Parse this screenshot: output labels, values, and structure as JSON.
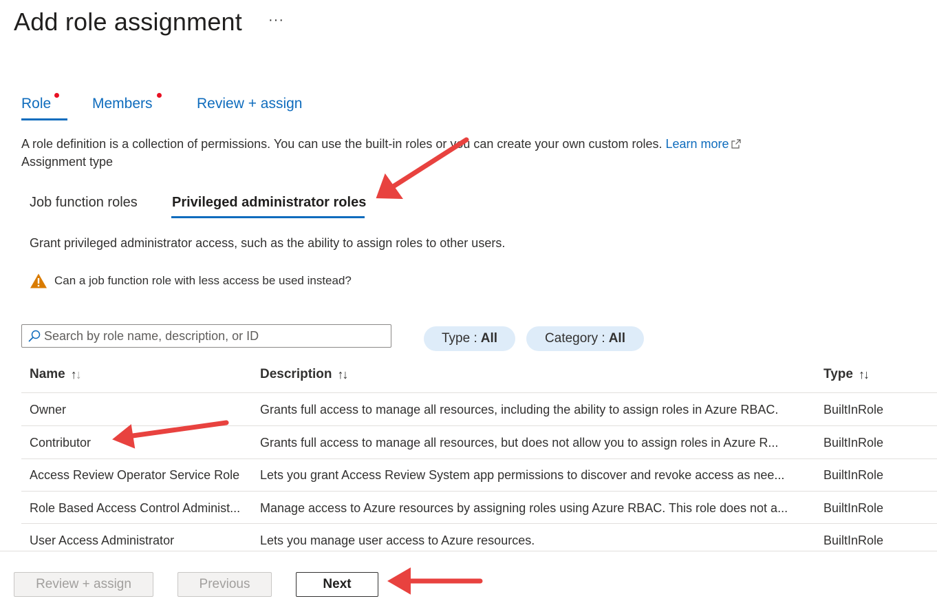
{
  "page": {
    "title": "Add role assignment",
    "more_label": "···"
  },
  "wizard_tabs": [
    {
      "label": "Role",
      "required": true,
      "active": true
    },
    {
      "label": "Members",
      "required": true,
      "active": false
    },
    {
      "label": "Review + assign",
      "required": false,
      "active": false
    }
  ],
  "intro": {
    "description": "A role definition is a collection of permissions. You can use the built-in roles or you can create your own custom roles.",
    "learn_more": "Learn more",
    "assignment_type_label": "Assignment type"
  },
  "role_type_tabs": [
    {
      "label": "Job function roles",
      "active": false
    },
    {
      "label": "Privileged administrator roles",
      "active": true
    }
  ],
  "privileged": {
    "description": "Grant privileged administrator access, such as the ability to assign roles to other users.",
    "warning": "Can a job function role with less access be used instead?"
  },
  "filters": {
    "search_placeholder": "Search by role name, description, or ID",
    "type_label": "Type :",
    "type_value": "All",
    "category_label": "Category :",
    "category_value": "All"
  },
  "table": {
    "columns": [
      {
        "label": "Name",
        "sort": "↑↓"
      },
      {
        "label": "Description",
        "sort": "↑↓"
      },
      {
        "label": "Type",
        "sort": "↑↓"
      }
    ],
    "rows": [
      {
        "name": "Owner",
        "description": "Grants full access to manage all resources, including the ability to assign roles in Azure RBAC.",
        "type": "BuiltInRole"
      },
      {
        "name": "Contributor",
        "description": "Grants full access to manage all resources, but does not allow you to assign roles in Azure R...",
        "type": "BuiltInRole"
      },
      {
        "name": "Access Review Operator Service Role",
        "description": "Lets you grant Access Review System app permissions to discover and revoke access as nee...",
        "type": "BuiltInRole"
      },
      {
        "name": "Role Based Access Control Administ...",
        "description": "Manage access to Azure resources by assigning roles using Azure RBAC. This role does not a...",
        "type": "BuiltInRole"
      },
      {
        "name": "User Access Administrator",
        "description": "Lets you manage user access to Azure resources.",
        "type": "BuiltInRole"
      }
    ]
  },
  "footer": {
    "review_assign": "Review + assign",
    "previous": "Previous",
    "next": "Next"
  },
  "colors": {
    "accent": "#0f6cbd",
    "required_dot": "#e81123",
    "pill_bg": "#deecf9",
    "warning": "#d97b00",
    "annotation_arrow": "#e8423f"
  },
  "icons": [
    "more-icon",
    "external-link-icon",
    "warning-icon",
    "search-icon",
    "sort-icon",
    "annotation-arrow"
  ]
}
